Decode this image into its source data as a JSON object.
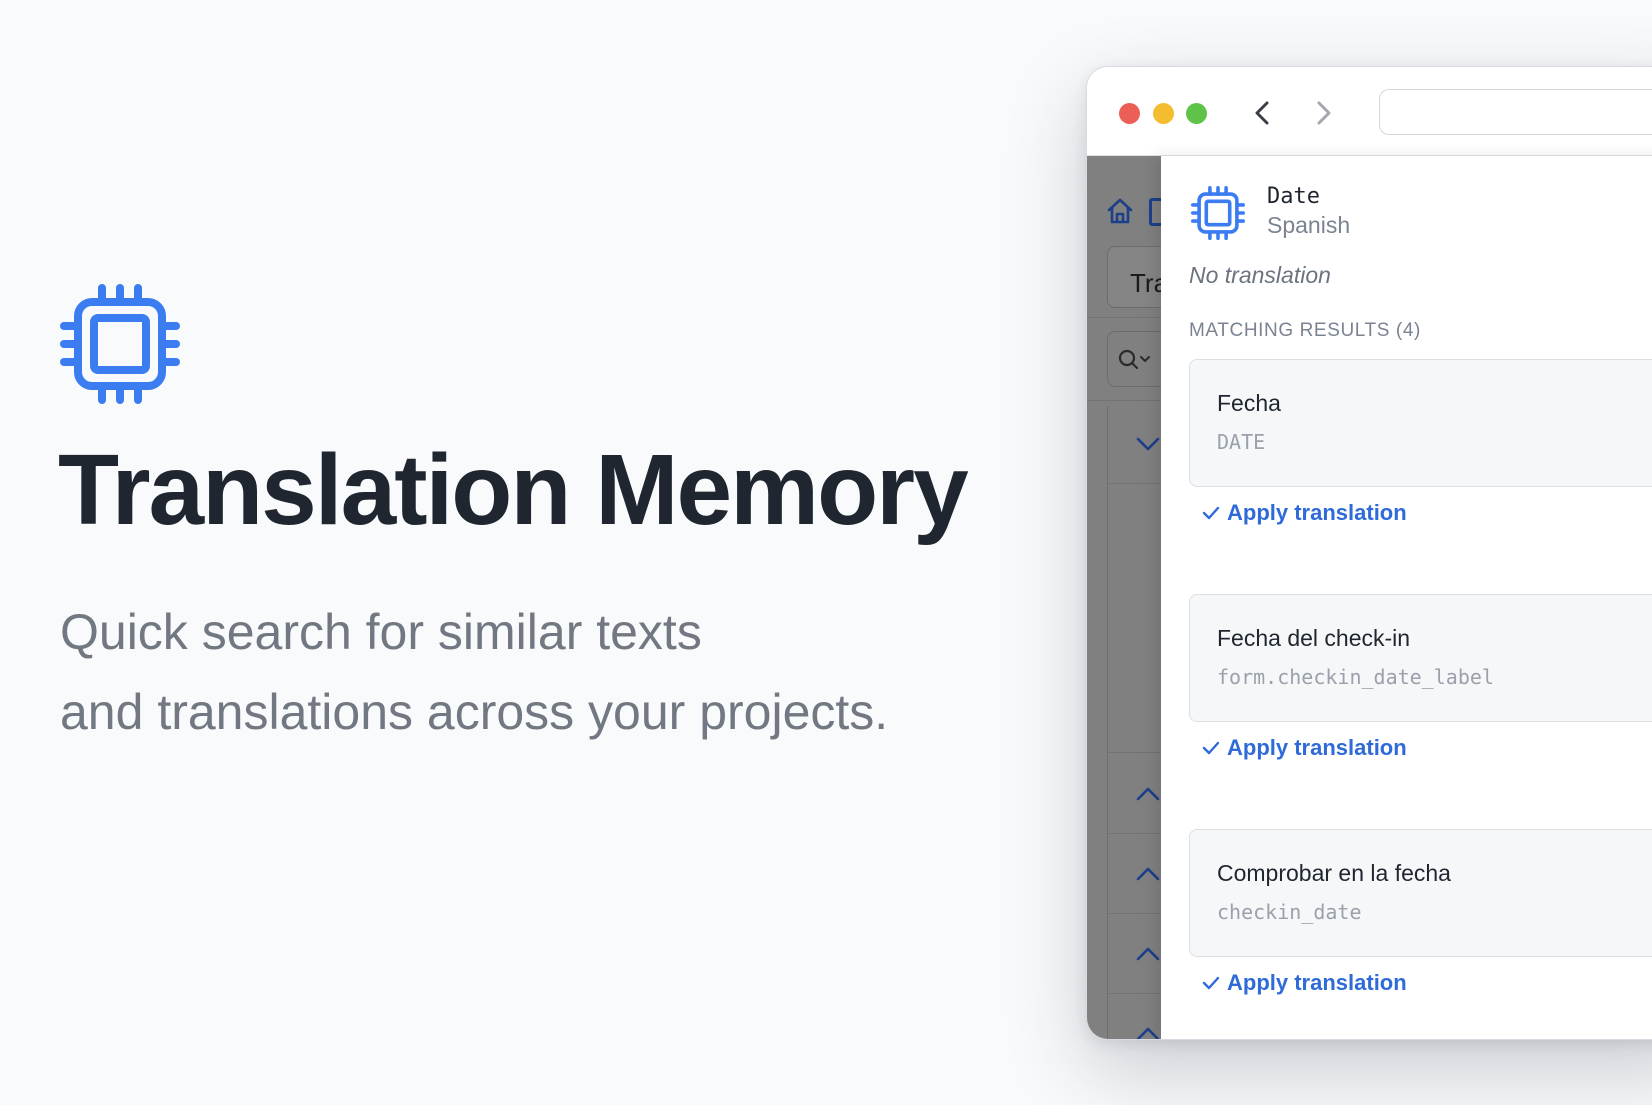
{
  "hero": {
    "icon": "cpu-chip-icon",
    "title": "Translation Memory",
    "subtitle_line1": "Quick search for similar texts",
    "subtitle_line2": "and translations across your projects."
  },
  "colors": {
    "accent": "#3b7cf0",
    "title": "#1f2630",
    "subtitle": "#727882",
    "link": "#2f6ad9"
  },
  "browser": {
    "traffic_lights": [
      "close",
      "minimize",
      "zoom"
    ],
    "back_icon": "chevron-left-icon",
    "forward_icon": "chevron-right-icon",
    "address": ""
  },
  "background_app": {
    "field_text": "Tra"
  },
  "panel": {
    "key_name": "Date",
    "language": "Spanish",
    "status": "No translation",
    "results_heading": "MATCHING RESULTS (4)",
    "results": [
      {
        "text": "Fecha",
        "key": "DATE",
        "action": "Apply translation"
      },
      {
        "text": "Fecha del check-in",
        "key": "form.checkin_date_label",
        "action": "Apply translation"
      },
      {
        "text": "Comprobar en la fecha",
        "key": "checkin_date",
        "action": "Apply translation"
      }
    ]
  }
}
